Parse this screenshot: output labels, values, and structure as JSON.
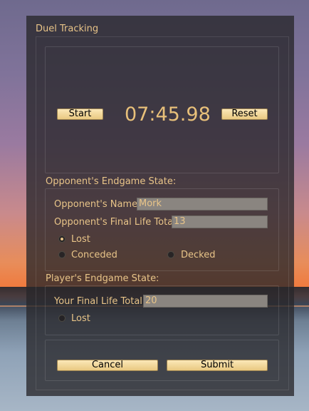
{
  "window": {
    "title": "Duel Tracking"
  },
  "timer": {
    "start_label": "Start",
    "time": "07:45.98",
    "reset_label": "Reset"
  },
  "opponent": {
    "section_label": "Opponent's Endgame State:",
    "name_label": "Opponent's Name:",
    "name_value": "Mork",
    "life_label": "Opponent's Final Life Total:",
    "life_value": "13",
    "options": [
      {
        "label": "Lost",
        "selected": true
      },
      {
        "label": "Conceded",
        "selected": false
      },
      {
        "label": "Decked",
        "selected": false
      }
    ]
  },
  "player": {
    "section_label": "Player's Endgame State:",
    "life_label": "Your Final Life Total:",
    "life_value": "20",
    "options": [
      {
        "label": "Lost",
        "selected": false
      }
    ]
  },
  "actions": {
    "cancel_label": "Cancel",
    "submit_label": "Submit"
  },
  "colors": {
    "accent_text": "#e8c488",
    "button_fill": "#f3d99c",
    "panel": "#28262a"
  }
}
